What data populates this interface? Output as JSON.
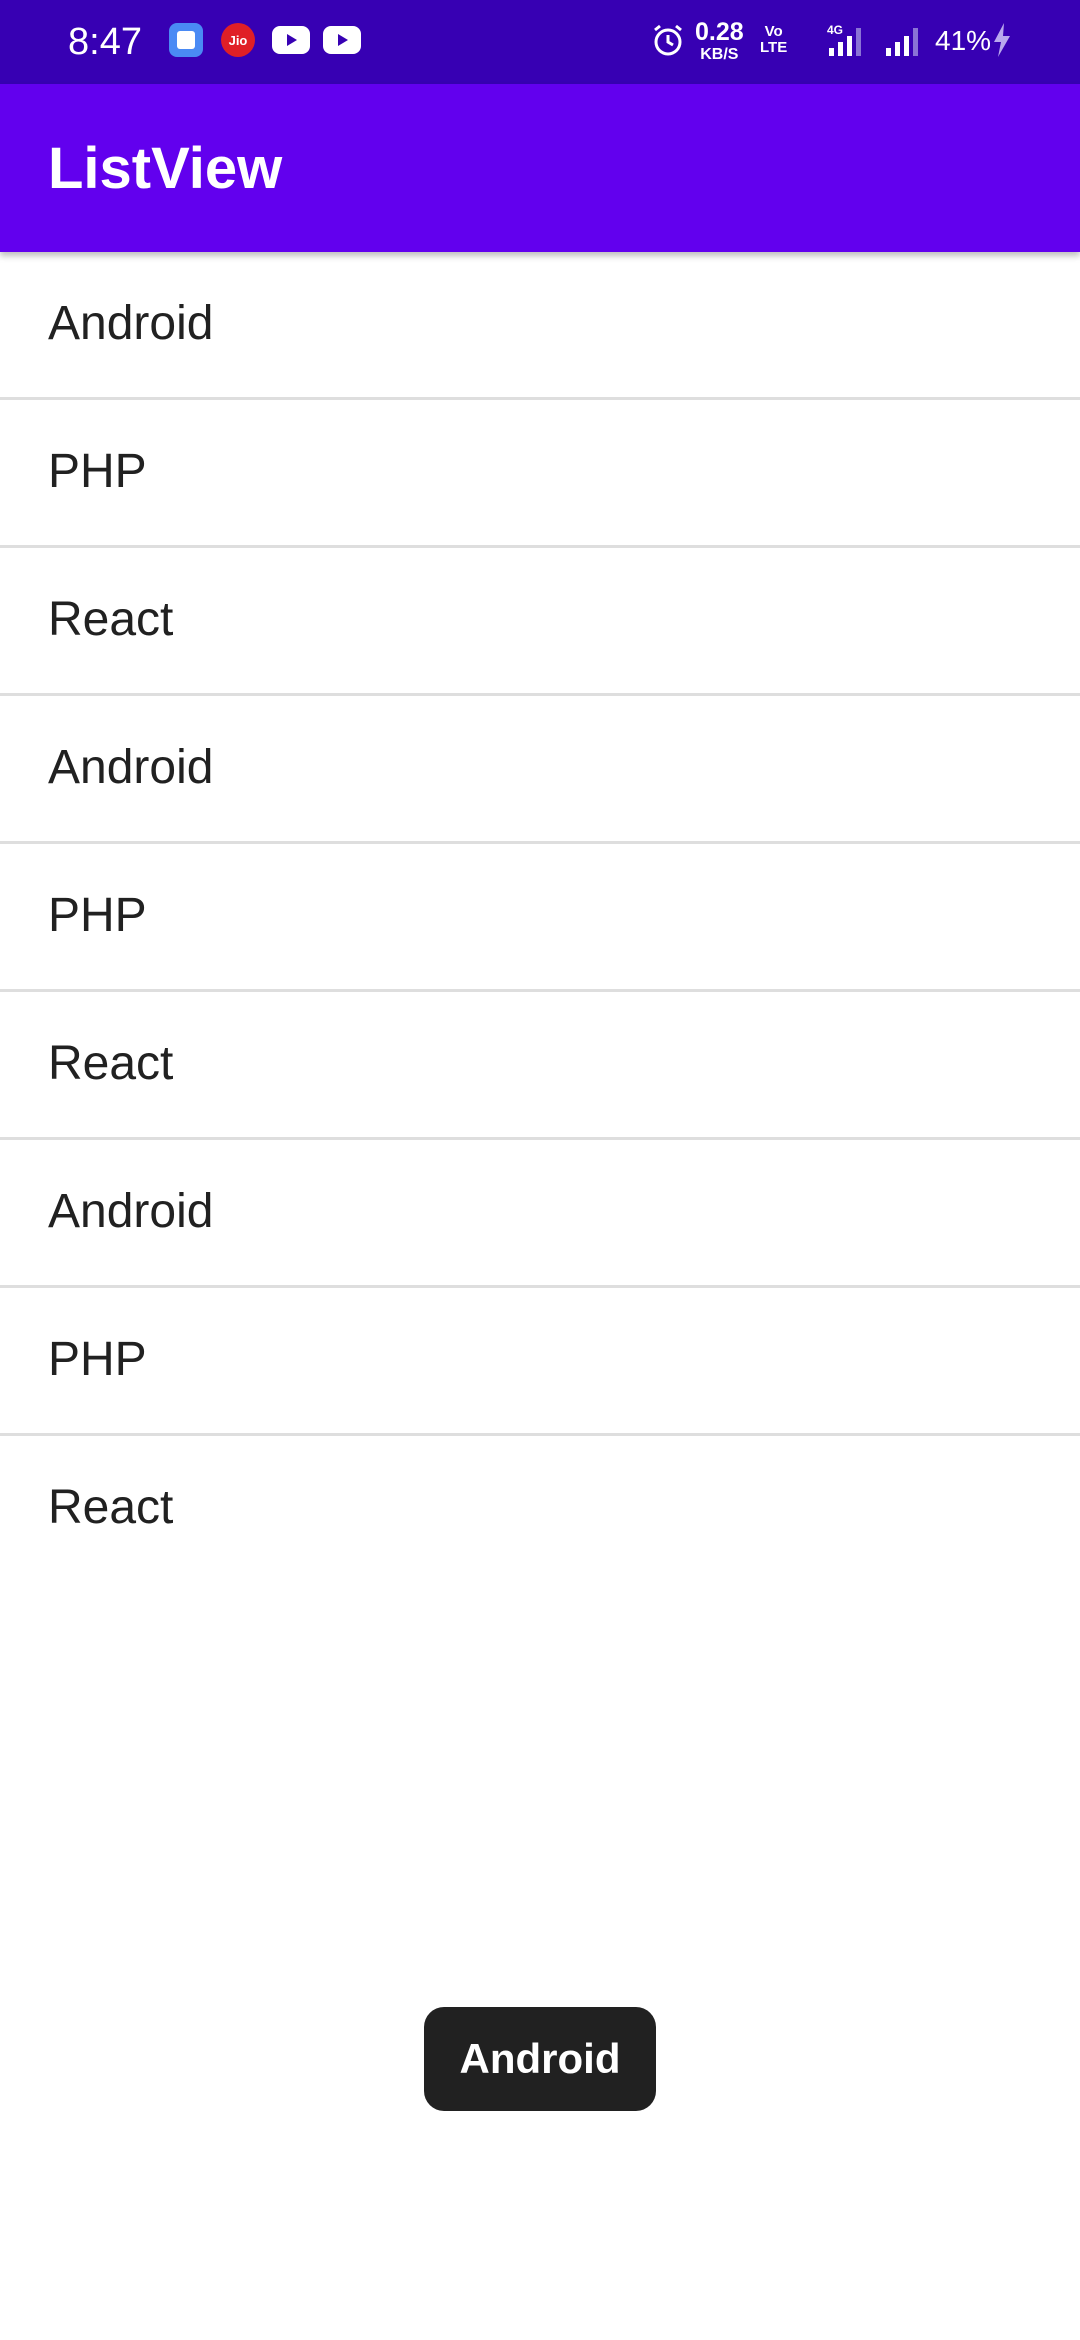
{
  "status_bar": {
    "time": "8:47",
    "net_speed_value": "0.28",
    "net_speed_unit": "KB/S",
    "volte_top": "Vo",
    "volte_bottom": "LTE",
    "network_type": "4G",
    "battery": "41%",
    "icons": [
      "app-icon",
      "jio-icon",
      "youtube-icon",
      "youtube-icon",
      "alarm-icon",
      "signal-icon",
      "signal-icon",
      "charging-icon"
    ]
  },
  "app_bar": {
    "title": "ListView",
    "color": "#6200ee",
    "status_color": "#3700b3"
  },
  "list": {
    "items": [
      "Android",
      "PHP",
      "React",
      "Android",
      "PHP",
      "React",
      "Android",
      "PHP",
      "React"
    ]
  },
  "toast": {
    "text": "Android"
  }
}
